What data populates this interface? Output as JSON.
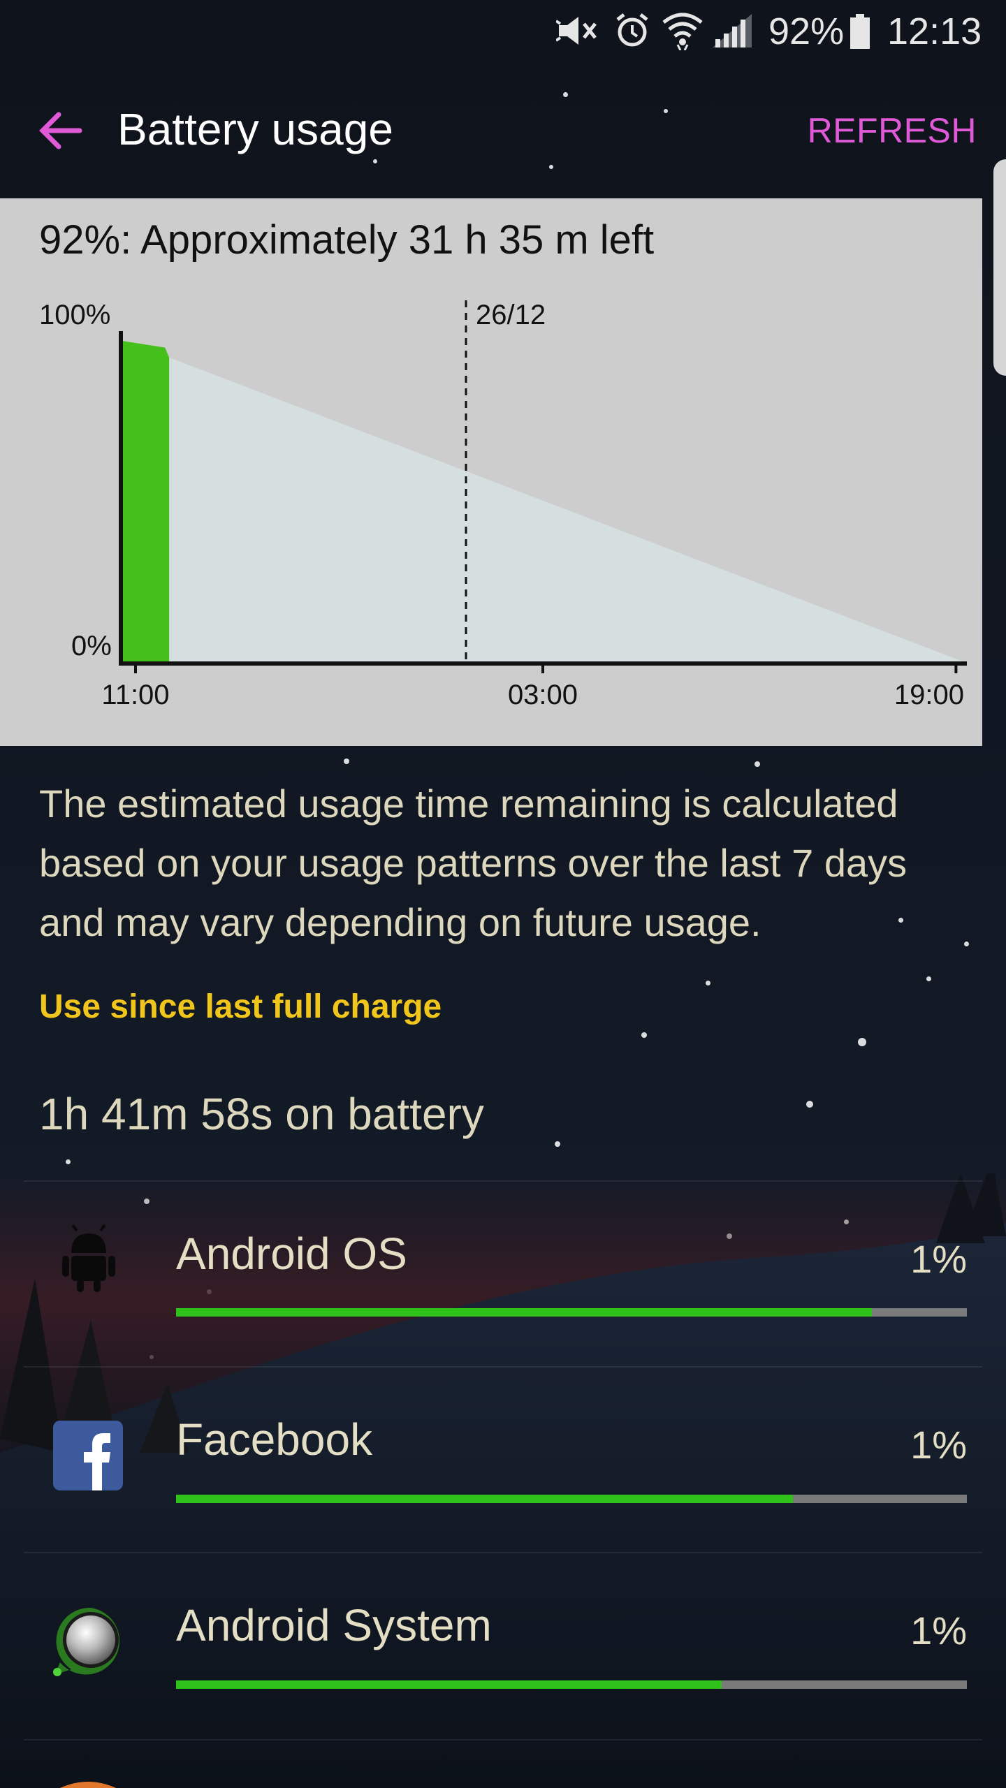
{
  "status_bar": {
    "battery_percent": "92%",
    "time": "12:13",
    "icons": [
      "mute-icon",
      "alarm-icon",
      "wifi-icon",
      "signal-icon",
      "battery-icon"
    ]
  },
  "app_bar": {
    "title": "Battery usage",
    "refresh_label": "REFRESH",
    "back_icon": "back-arrow-icon"
  },
  "estimate": {
    "headline": "92%: Approximately 31 h 35 m left"
  },
  "chart_data": {
    "type": "area",
    "ylabels": [
      "100%",
      "0%"
    ],
    "xticks": [
      "11:00",
      "03:00",
      "19:00"
    ],
    "date_marker": "26/12",
    "series": [
      {
        "values": [
          [
            0,
            97
          ],
          [
            0.05,
            95
          ],
          [
            0.055,
            92
          ]
        ],
        "color": "#45c01a"
      },
      {
        "values": [
          [
            0.055,
            92
          ],
          [
            1.0,
            0
          ]
        ],
        "color": "#d5dfe0"
      }
    ],
    "ylim": [
      0,
      100
    ],
    "grid": false
  },
  "description": "The estimated usage time remaining is calculated based on your usage patterns over the last 7 days and may vary depending on future usage.",
  "section_header": "Use since last full charge",
  "on_battery": "1h 41m 58s on battery",
  "apps": [
    {
      "name": "Android OS",
      "percent": "1%",
      "bar_fraction": 0.88,
      "icon": "android-icon"
    },
    {
      "name": "Facebook",
      "percent": "1%",
      "bar_fraction": 0.78,
      "icon": "facebook-icon"
    },
    {
      "name": "Android System",
      "percent": "1%",
      "bar_fraction": 0.69,
      "icon": "android-system-icon"
    }
  ],
  "colors": {
    "accent": "#e05ad8",
    "section": "#f0c51c",
    "bar": "#2fc21a",
    "text": "#e4dfc4"
  }
}
